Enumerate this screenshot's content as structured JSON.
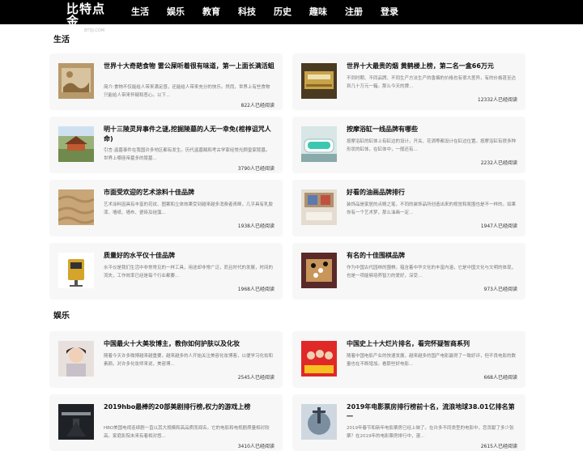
{
  "header": {
    "logo_text": "比特点金",
    "logo_sub": "BTDJ.COM",
    "nav": [
      "生活",
      "娱乐",
      "教育",
      "科技",
      "历史",
      "趣味",
      "注册",
      "登录"
    ]
  },
  "sections": [
    {
      "title": "生活",
      "cards": [
        {
          "title": "世界十大奇葩食物 雷公屎听着很有味道，第一上面长满活蛆",
          "desc": "简介:食物不仅能给人带来满足感，还能给人带来充分的快乐。然而，世界上有些食物只能给人带来怀疑和恶心。以下...",
          "count": "822人已经阅读",
          "thumb": "thumb-food"
        },
        {
          "title": "世界十大最贵的烟 黄鹤楼上榜，第二名一盒66万元",
          "desc": "不同时期、不同品牌、不同生产方法生产的香烟的价格也有很大差异，有的价格甚至达到几十万元一箱。那么今天的牌...",
          "count": "12332人已经阅读",
          "thumb": "thumb-cigarette"
        },
        {
          "title": "明十三陵灵异事件之谜,挖掘陵墓的人无一幸免(棺椁诅咒人命)",
          "desc": "引言:盗墓事件在我国许多地区都有发生。历代盗墓贼和考古学家经常光顾皇家陵墓。世界上哪座帝墓多的陵墓...",
          "count": "3790人已经阅读",
          "thumb": "thumb-tomb"
        },
        {
          "title": "按摩浴缸一线品牌有哪些",
          "desc": "按摩浴缸的缸体上有缸边的设计，开关、花洒等都设计在缸边位置。按摩浴缸有很多种形状的缸体，在缸体中，一般还有...",
          "count": "2232人已经阅读",
          "thumb": "thumb-bathtub"
        },
        {
          "title": "市面受欢迎的艺术涂料十佳品牌",
          "desc": "艺术涂料因具有丰富的花纹、图案和立体效果受到越来越多消费者青睐，几乎具有乳胶漆、墙纸、墙布、瓷砖及硅藻...",
          "count": "1938人已经阅读",
          "thumb": "thumb-paint"
        },
        {
          "title": "好看的油画品牌排行",
          "desc": "装饰品是家居的点睛之笔，不同的装饰品所创造出来的视觉和氛围也是不一样的。如果你有一个艺术梦，那么油画一定...",
          "count": "1947人已经阅读",
          "thumb": "thumb-oilpaint"
        },
        {
          "title": "质量好的水平仪十佳品牌",
          "desc": "水平仪是我们生活中非常常见的一样工具，用途却非常广泛，而且时代的发展，时间的流失，工作效率已经是每个行业都要...",
          "count": "1968人已经阅读",
          "thumb": "thumb-level"
        },
        {
          "title": "有名的十佳围棋品牌",
          "desc": "作为中国古代园林的围棋，蕴含着中华文化的丰富内涵，它是中国文化与文明的体现，也是一项能够培养智力的爱好，深受...",
          "count": "973人已经阅读",
          "thumb": "thumb-go"
        }
      ]
    },
    {
      "title": "娱乐",
      "cards": [
        {
          "title": "中国最火十大美妆博主，教你如何护肤以及化妆",
          "desc": "随着今天许多微博越来越重要，越来越多的人开始关注美容化妆博客，以便学习化妆和素颜。对许多化妆师来说，美容博...",
          "count": "2545人已经阅读",
          "thumb": "thumb-blogger"
        },
        {
          "title": "中国史上十大烂片排名，看完怀疑智商系列",
          "desc": "随着中国电影产业的快速发展，越来越多的国产电影赢得了一致好评，但不良电影的数量也在不断增加。看那些好电影...",
          "count": "668人已经阅读",
          "thumb": "thumb-movies"
        },
        {
          "title": "2019hbo最棒的20部美剧排行榜,权力的游戏上榜",
          "desc": "HBO美国电视连续剧一直以其大规模和高品质而闻名。它的电影和电视剧质量相对较高。家庭影院未来有着相对悠...",
          "count": "3410人已经阅读",
          "thumb": "thumb-got"
        },
        {
          "title": "2019年电影票房排行榜前十名，流浪地球38.01亿排名第一",
          "desc": "2019年春节和新年电影票房已经上映了。在许多不同类型的电影中，您贡献了多少张票？在2019年的电影票房排行中，漫...",
          "count": "2615人已经阅读",
          "thumb": "thumb-earth"
        }
      ]
    }
  ]
}
